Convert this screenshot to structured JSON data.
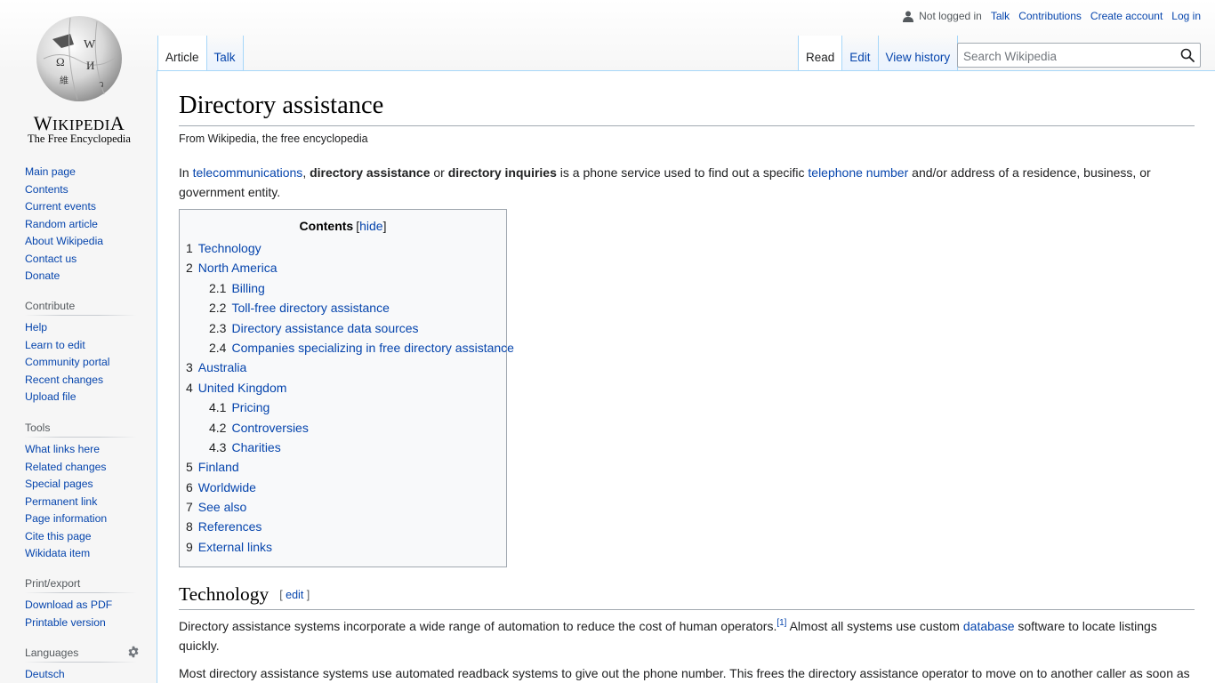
{
  "logo": {
    "wordmark_first": "W",
    "wordmark_rest": "IKIPEDI",
    "wordmark_last": "A",
    "tagline": "The Free Encyclopedia"
  },
  "personal_tools": {
    "status": "Not logged in",
    "links": [
      "Talk",
      "Contributions",
      "Create account",
      "Log in"
    ]
  },
  "namespace_tabs": [
    {
      "label": "Article",
      "selected": true
    },
    {
      "label": "Talk",
      "selected": false
    }
  ],
  "view_tabs": [
    {
      "label": "Read",
      "selected": true
    },
    {
      "label": "Edit",
      "selected": false
    },
    {
      "label": "View history",
      "selected": false
    }
  ],
  "search": {
    "placeholder": "Search Wikipedia",
    "value": "",
    "icon": "search-icon"
  },
  "sidebar": {
    "navigation": [
      "Main page",
      "Contents",
      "Current events",
      "Random article",
      "About Wikipedia",
      "Contact us",
      "Donate"
    ],
    "contribute": {
      "heading": "Contribute",
      "items": [
        "Help",
        "Learn to edit",
        "Community portal",
        "Recent changes",
        "Upload file"
      ]
    },
    "tools": {
      "heading": "Tools",
      "items": [
        "What links here",
        "Related changes",
        "Special pages",
        "Permanent link",
        "Page information",
        "Cite this page",
        "Wikidata item"
      ]
    },
    "print": {
      "heading": "Print/export",
      "items": [
        "Download as PDF",
        "Printable version"
      ]
    },
    "languages": {
      "heading": "Languages",
      "icon": "gear-icon",
      "items": [
        "Deutsch"
      ]
    }
  },
  "article": {
    "title": "Directory assistance",
    "site_sub": "From Wikipedia, the free encyclopedia",
    "intro": {
      "t1": "In ",
      "link1": "telecommunications",
      "t2": ", ",
      "b1": "directory assistance",
      "t3": " or ",
      "b2": "directory inquiries",
      "t4": " is a phone service used to find out a specific ",
      "link2": "telephone number",
      "t5": " and/or address of a residence, business, or government entity."
    },
    "toc": {
      "title": "Contents",
      "toggle_open": "[",
      "toggle": "hide",
      "toggle_close": "]",
      "items": [
        {
          "num": "1",
          "label": "Technology",
          "level": 1
        },
        {
          "num": "2",
          "label": "North America",
          "level": 1
        },
        {
          "num": "2.1",
          "label": "Billing",
          "level": 2
        },
        {
          "num": "2.2",
          "label": "Toll-free directory assistance",
          "level": 2
        },
        {
          "num": "2.3",
          "label": "Directory assistance data sources",
          "level": 2
        },
        {
          "num": "2.4",
          "label": "Companies specializing in free directory assistance",
          "level": 2
        },
        {
          "num": "3",
          "label": "Australia",
          "level": 1
        },
        {
          "num": "4",
          "label": "United Kingdom",
          "level": 1
        },
        {
          "num": "4.1",
          "label": "Pricing",
          "level": 2
        },
        {
          "num": "4.2",
          "label": "Controversies",
          "level": 2
        },
        {
          "num": "4.3",
          "label": "Charities",
          "level": 2
        },
        {
          "num": "5",
          "label": "Finland",
          "level": 1
        },
        {
          "num": "6",
          "label": "Worldwide",
          "level": 1
        },
        {
          "num": "7",
          "label": "See also",
          "level": 1
        },
        {
          "num": "8",
          "label": "References",
          "level": 1
        },
        {
          "num": "9",
          "label": "External links",
          "level": 1
        }
      ]
    },
    "section_technology": {
      "heading": "Technology",
      "edit_open": "[ ",
      "edit": "edit",
      "edit_close": " ]",
      "p1": {
        "t1": "Directory assistance systems incorporate a wide range of automation to reduce the cost of human operators.",
        "ref": "[1]",
        "t2": " Almost all systems use custom ",
        "link": "database",
        "t3": " software to locate listings quickly."
      },
      "p2": "Most directory assistance systems use automated readback systems to give out the phone number. This frees the directory assistance operator to move on to another caller as soon as"
    }
  }
}
